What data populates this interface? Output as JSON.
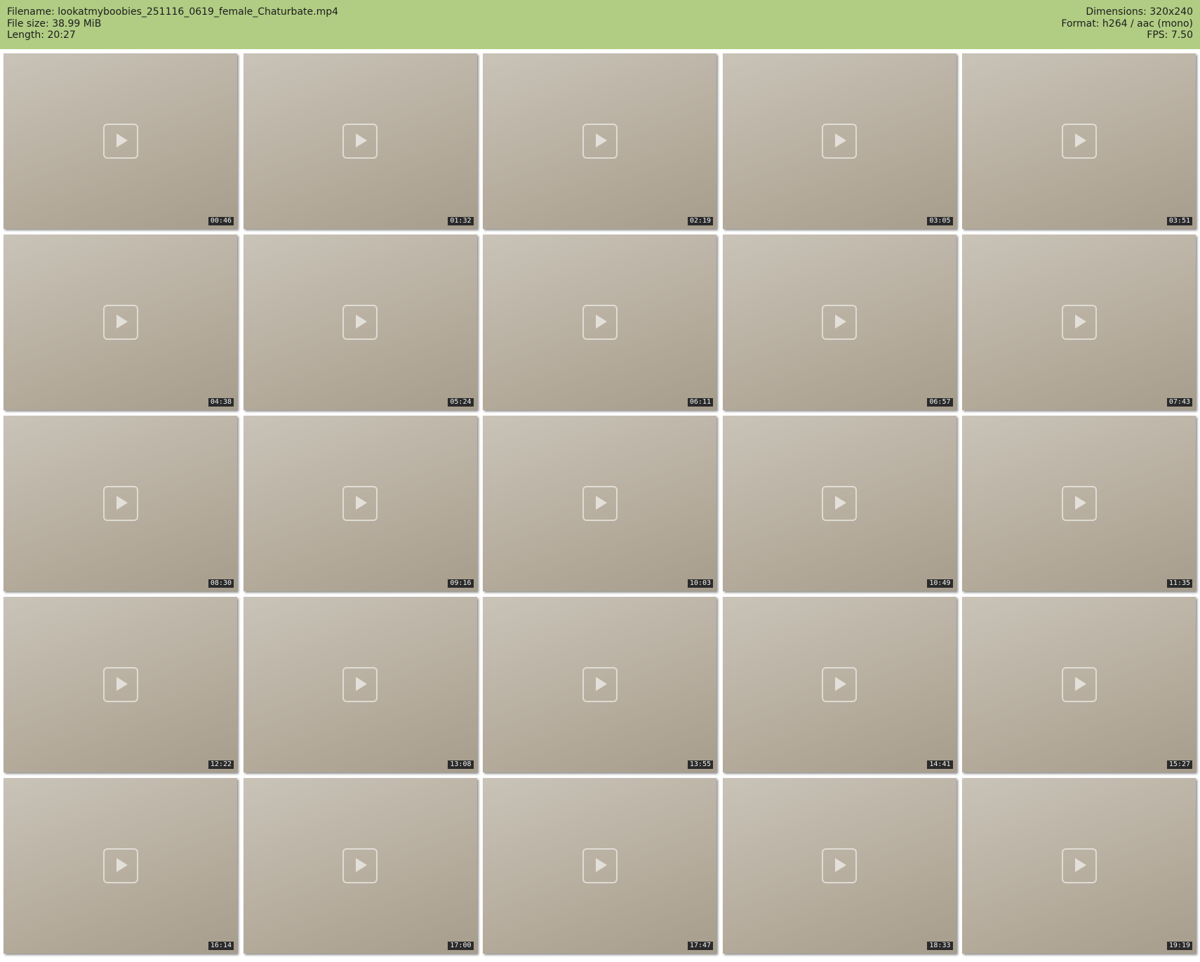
{
  "header": {
    "filename": "Filename: lookatmyboobies_251116_0619_female_Chaturbate.mp4",
    "filesize": "File size: 38.99 MiB",
    "length": "Length: 20:27",
    "dimensions": "Dimensions: 320x240",
    "format": "Format: h264 / aac (mono)",
    "fps": "FPS: 7.50"
  },
  "frames": [
    "00:46",
    "01:32",
    "02:19",
    "03:05",
    "03:51",
    "04:38",
    "05:24",
    "06:11",
    "06:57",
    "07:43",
    "08:30",
    "09:16",
    "10:03",
    "10:49",
    "11:35",
    "12:22",
    "13:08",
    "13:55",
    "14:41",
    "15:27",
    "16:14",
    "17:00",
    "17:47",
    "18:33",
    "19:19"
  ]
}
